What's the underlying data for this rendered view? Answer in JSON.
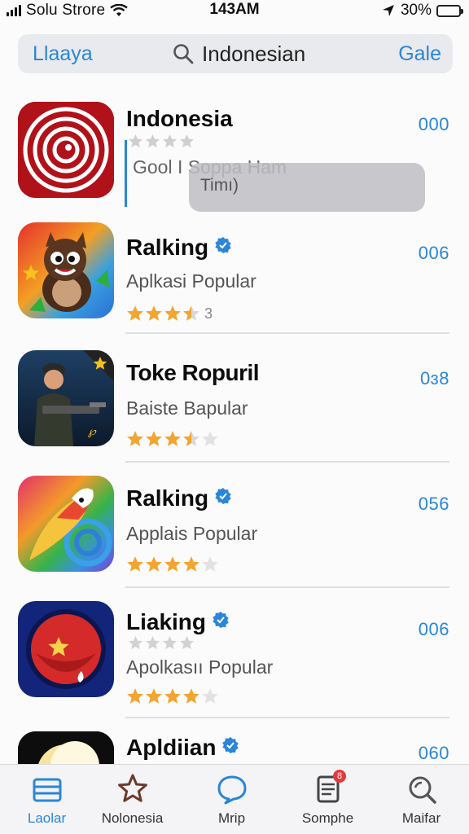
{
  "status_bar": {
    "carrier": "Solu Strore",
    "time": "143AM",
    "battery": "30%",
    "battery_level": 0.3
  },
  "header": {
    "left_label": "Llaaya",
    "search_value": "Indonesian",
    "right_label": "Gale"
  },
  "popup_text": "Timı)",
  "apps": [
    {
      "name": "Indonesia",
      "subtitle": "Gool I Soppa Ham",
      "code": "000",
      "verified": false,
      "rating_label": ""
    },
    {
      "name": "Ralking",
      "subtitle": "Aplkasi Popular",
      "code": "006",
      "verified": true,
      "rating_label": "3"
    },
    {
      "name": "Toke Ropuril",
      "subtitle": "Baiste Bapular",
      "code": "0ɜ8",
      "verified": false,
      "rating_label": ""
    },
    {
      "name": "Ralking",
      "subtitle": "Applais Popular",
      "code": "056",
      "verified": true,
      "rating_label": ""
    },
    {
      "name": "Liaking",
      "subtitle": "Apolkasıı Popular",
      "code": "006",
      "verified": true,
      "rating_label": ""
    },
    {
      "name": "Apldiian",
      "subtitle": "",
      "code": "060",
      "verified": true,
      "rating_label": ""
    }
  ],
  "tabs": [
    {
      "label": "Laolar",
      "icon": "list-icon",
      "active": true
    },
    {
      "label": "Nolonesia",
      "icon": "star-icon",
      "active": false
    },
    {
      "label": "Mrip",
      "icon": "chat-icon",
      "active": false
    },
    {
      "label": "Somphe",
      "icon": "document-icon",
      "active": false,
      "badge": "8"
    },
    {
      "label": "Maifar",
      "icon": "search-icon",
      "active": false
    }
  ],
  "colors": {
    "accent": "#2a86d8",
    "star": "#f2a530",
    "badge": "#e5393b"
  }
}
